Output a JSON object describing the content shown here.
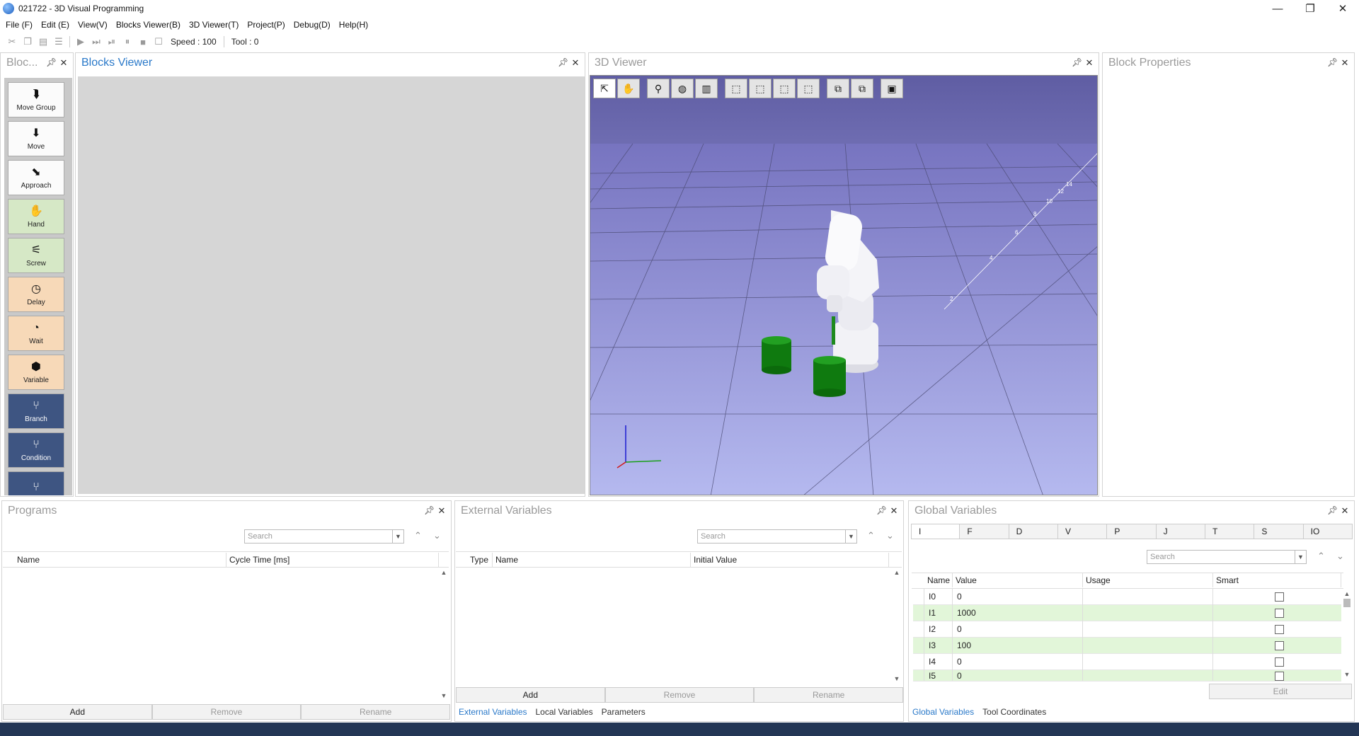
{
  "window": {
    "title": "021722 - 3D Visual Programming",
    "minimize": "—",
    "restore": "❐",
    "close": "✕"
  },
  "menu": [
    "File (F)",
    "Edit (E)",
    "View(V)",
    "Blocks Viewer(B)",
    "3D Viewer(T)",
    "Project(P)",
    "Debug(D)",
    "Help(H)"
  ],
  "toolbar": {
    "speed": "Speed : 100",
    "tool": "Tool : 0"
  },
  "panels": {
    "blocks_palette": "Bloc...",
    "blocks_viewer": "Blocks Viewer",
    "viewer_3d": "3D Viewer",
    "block_properties": "Block Properties",
    "programs": "Programs",
    "external_variables": "External Variables",
    "global_variables": "Global Variables"
  },
  "blocks": [
    {
      "label": "Move Group",
      "icon": "⮯",
      "color": "white"
    },
    {
      "label": "Move",
      "icon": "⬇",
      "color": "white"
    },
    {
      "label": "Approach",
      "icon": "⬊",
      "color": "white"
    },
    {
      "label": "Hand",
      "icon": "✋",
      "color": "green"
    },
    {
      "label": "Screw",
      "icon": "⚟",
      "color": "green"
    },
    {
      "label": "Delay",
      "icon": "◷",
      "color": "orange"
    },
    {
      "label": "Wait",
      "icon": "◔",
      "color": "orange"
    },
    {
      "label": "Variable",
      "icon": "⬢",
      "color": "orange"
    },
    {
      "label": "Branch",
      "icon": "⑂",
      "color": "blue"
    },
    {
      "label": "Condition",
      "icon": "⑂",
      "color": "blue"
    },
    {
      "label": "",
      "icon": "⑂",
      "color": "blue"
    }
  ],
  "axis_labels": [
    "2",
    "4",
    "6",
    "8",
    "10",
    "12",
    "14"
  ],
  "programs": {
    "search_placeholder": "Search",
    "columns": [
      "Name",
      "Cycle Time [ms]"
    ],
    "buttons": [
      "Add",
      "Remove",
      "Rename"
    ]
  },
  "external": {
    "search_placeholder": "Search",
    "columns": [
      "Type",
      "Name",
      "Initial Value"
    ],
    "buttons": [
      "Add",
      "Remove",
      "Rename"
    ],
    "tabs": [
      "External Variables",
      "Local Variables",
      "Parameters"
    ]
  },
  "global": {
    "type_tabs": [
      "I",
      "F",
      "D",
      "V",
      "P",
      "J",
      "T",
      "S",
      "IO"
    ],
    "search_placeholder": "Search",
    "columns": [
      "Name",
      "Value",
      "Usage",
      "Smart"
    ],
    "rows": [
      {
        "name": "I0",
        "value": "0"
      },
      {
        "name": "I1",
        "value": "1000"
      },
      {
        "name": "I2",
        "value": "0"
      },
      {
        "name": "I3",
        "value": "100"
      },
      {
        "name": "I4",
        "value": "0"
      },
      {
        "name": "I5",
        "value": "0"
      }
    ],
    "edit_button": "Edit",
    "tabs": [
      "Global Variables",
      "Tool Coordinates"
    ]
  }
}
